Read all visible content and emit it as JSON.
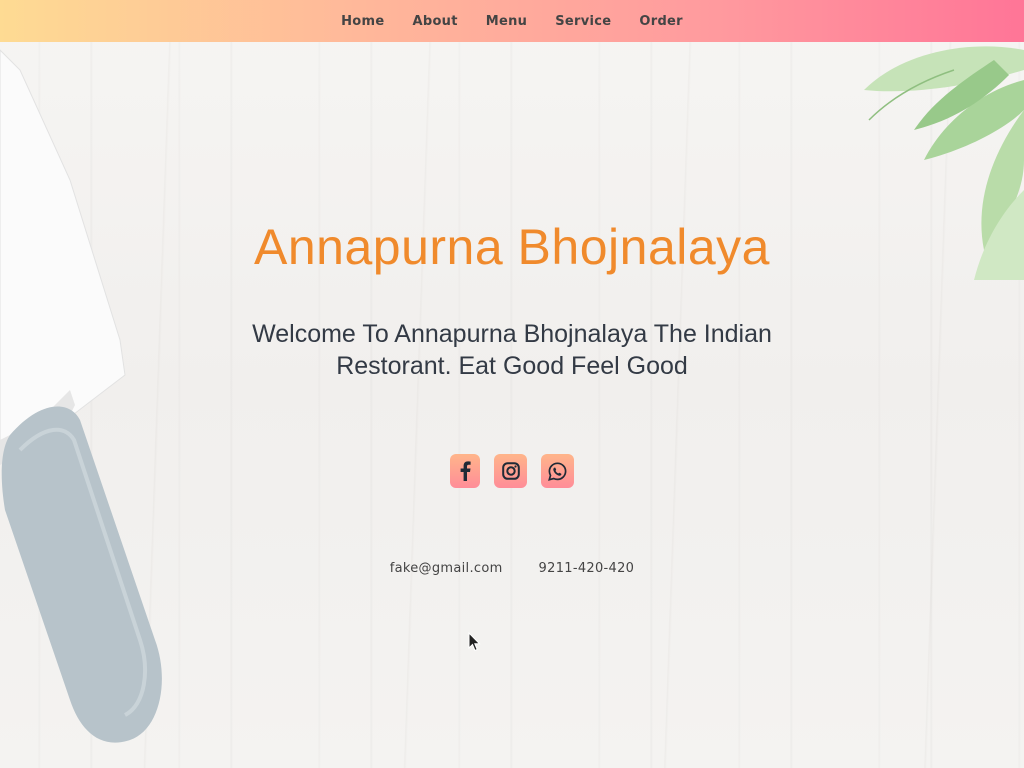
{
  "nav": {
    "items": [
      {
        "label": "Home"
      },
      {
        "label": "About"
      },
      {
        "label": "Menu"
      },
      {
        "label": "Service"
      },
      {
        "label": "Order"
      }
    ]
  },
  "hero": {
    "title": "Annapurna Bhojnalaya",
    "subtitle": "Welcome To Annapurna Bhojnalaya The Indian Restorant. Eat Good Feel Good"
  },
  "socials": [
    {
      "icon": "facebook-icon"
    },
    {
      "icon": "instagram-icon"
    },
    {
      "icon": "whatsapp-icon"
    }
  ],
  "contact": {
    "email": "fake@gmail.com",
    "phone": "9211-420-420"
  },
  "colors": {
    "title": "#f08a2c",
    "nav_gradient_start": "#fedb93",
    "nav_gradient_end": "#ff7597",
    "text": "#333a45"
  }
}
